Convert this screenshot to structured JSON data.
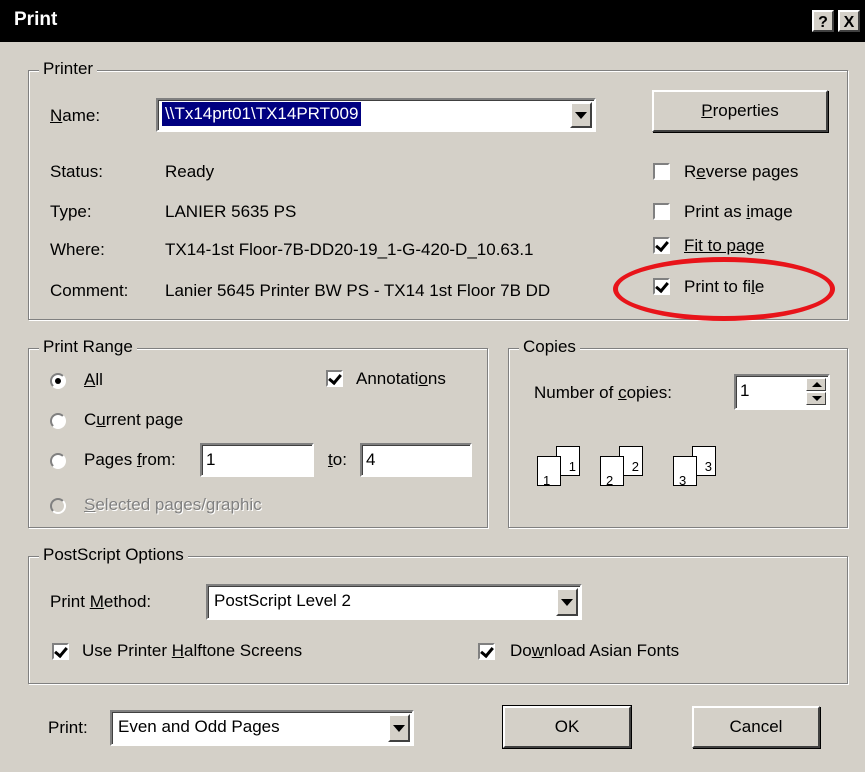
{
  "dialog": {
    "title": "Print",
    "help_button": "?",
    "close_button": "X"
  },
  "printer": {
    "legend": "Printer",
    "name_label": "Name:",
    "name_value": "\\\\Tx14prt01\\TX14PRT009",
    "properties_button": "Properties",
    "status_label": "Status:",
    "status_value": "Ready",
    "type_label": "Type:",
    "type_value": "LANIER 5635 PS",
    "where_label": "Where:",
    "where_value": "TX14-1st Floor-7B-DD20-19_1-G-420-D_10.63.1",
    "comment_label": "Comment:",
    "comment_value": "Lanier 5645 Printer BW PS - TX14 1st Floor 7B DD",
    "options": [
      {
        "label": "Reverse pages",
        "checked": false
      },
      {
        "label": "Print as image",
        "checked": false
      },
      {
        "label": "Fit to page",
        "checked": true
      },
      {
        "label": "Print to file",
        "checked": true
      }
    ],
    "highlight_color": "#e8141a"
  },
  "print_range": {
    "legend": "Print Range",
    "all_label": "All",
    "current_page_label": "Current page",
    "pages_label": "Pages",
    "from_label": "from:",
    "from_value": "1",
    "to_label": "to:",
    "to_value": "4",
    "selected_label": "Selected pages/graphic",
    "annotations_label": "Annotations",
    "annotations_checked": true,
    "selected_option": "All"
  },
  "copies": {
    "legend": "Copies",
    "number_label": "Number of copies:",
    "number_value": "1",
    "collate_pages": [
      "1",
      "1",
      "2",
      "2",
      "3",
      "3"
    ]
  },
  "postscript": {
    "legend": "PostScript Options",
    "method_label": "Print Method:",
    "method_value": "PostScript Level 2",
    "halftone_label": "Use Printer Halftone Screens",
    "halftone_checked": true,
    "asian_fonts_label": "Download Asian Fonts",
    "asian_fonts_checked": true
  },
  "footer": {
    "print_label": "Print:",
    "print_value": "Even and Odd Pages",
    "ok_button": "OK",
    "cancel_button": "Cancel"
  }
}
